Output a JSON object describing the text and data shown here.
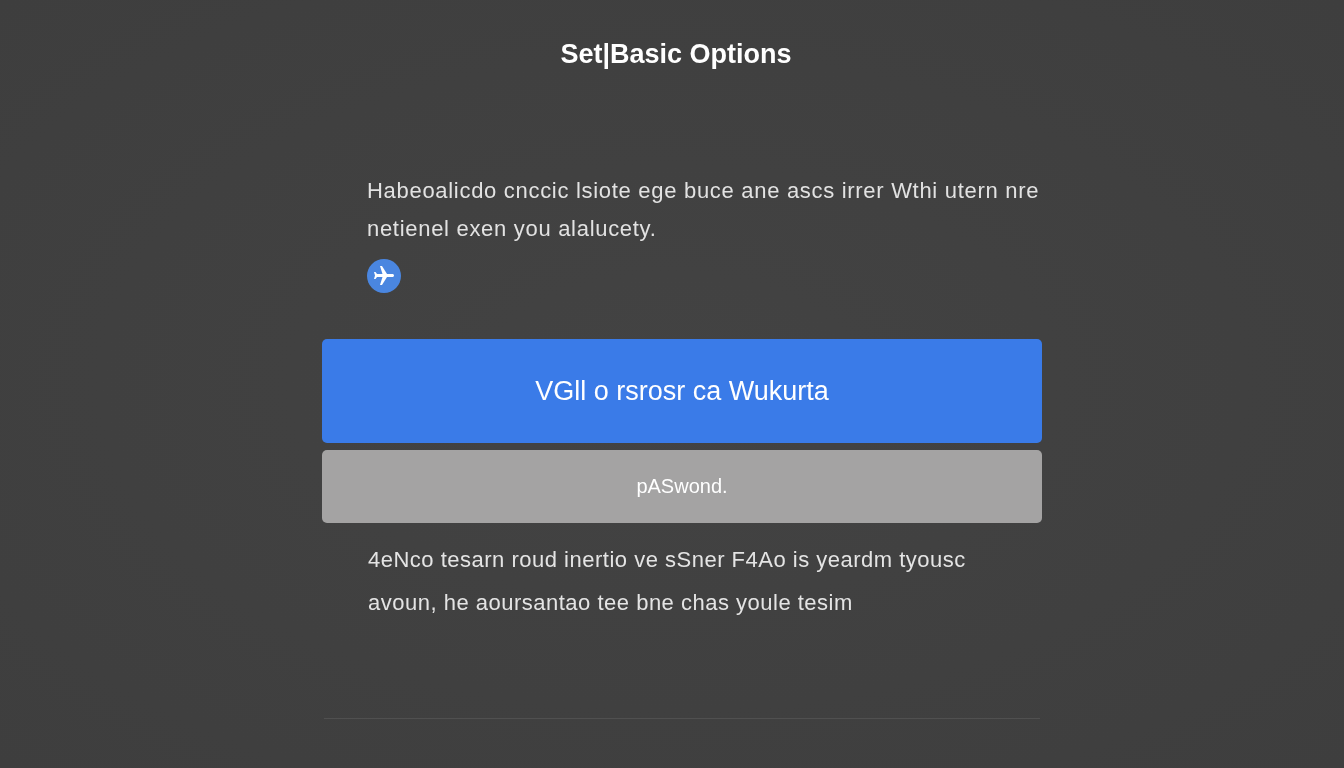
{
  "header": {
    "title": "Set|Basic Options"
  },
  "intro": {
    "text": "Habeoalicdo cnccic lsiote ege buce ane ascs irrer Wthi utern nre netienel exen you alalucety."
  },
  "actions": [
    {
      "kind": "primary",
      "label": "VGll o rsrosr ca Wukurta"
    },
    {
      "kind": "secondary",
      "label": "pASwond."
    }
  ],
  "note": {
    "text": "4eNco tesarn roud inertio ve sSner F4Ao is yeardm tyousc avoun, he aoursantao tee bne chas youle tesim"
  }
}
